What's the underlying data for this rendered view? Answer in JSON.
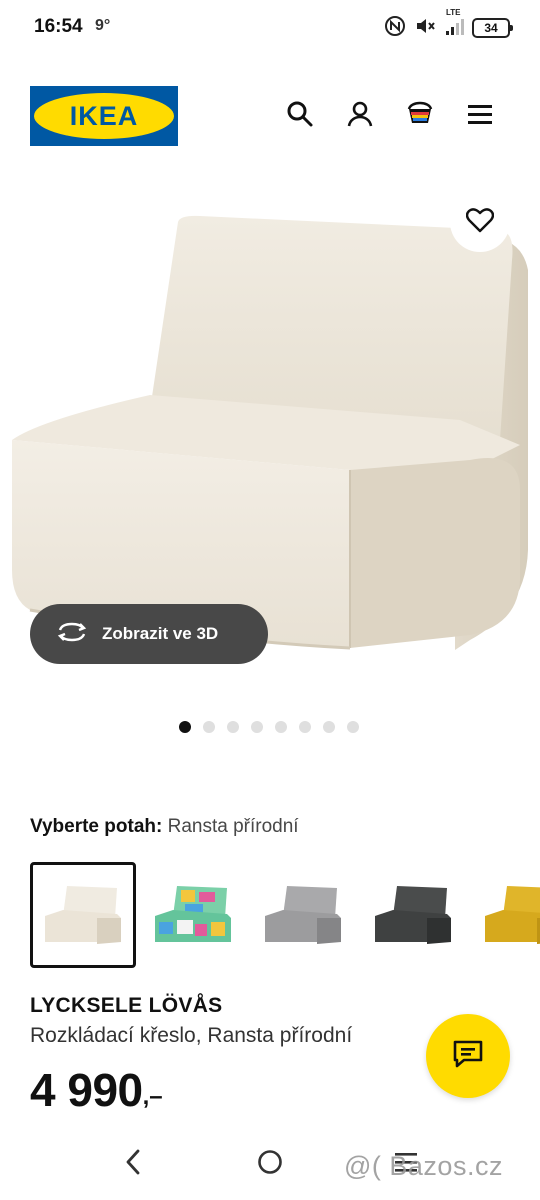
{
  "status_bar": {
    "time": "16:54",
    "temperature": "9°",
    "battery": "34",
    "icons": [
      "nfc-icon",
      "mute-icon",
      "lte-signal-icon",
      "battery-icon"
    ],
    "network_label": "LTE"
  },
  "header": {
    "logo_text": "IKEA",
    "icons": [
      "search-icon",
      "account-icon",
      "cart-icon",
      "menu-icon"
    ],
    "colors": {
      "ikea_blue": "#0058a3",
      "ikea_yellow": "#ffdb00"
    }
  },
  "gallery": {
    "favorite_icon": "heart-icon",
    "view_3d_label": "Zobrazit ve 3D",
    "view_3d_icon": "rotate-icon",
    "dot_count": 8,
    "active_dot": 0
  },
  "cover": {
    "label": "Vyberte potah:",
    "value": "Ransta přírodní",
    "swatches": [
      {
        "name": "ransta-natural",
        "color": "#efe9de",
        "selected": true
      },
      {
        "name": "multicolor",
        "color": "#6ec6a0",
        "selected": false
      },
      {
        "name": "light-grey",
        "color": "#9d9d9f",
        "selected": false
      },
      {
        "name": "dark-grey",
        "color": "#3f4141",
        "selected": false
      },
      {
        "name": "yellow",
        "color": "#d9ad1f",
        "selected": false
      }
    ]
  },
  "product": {
    "name": "LYCKSELE LÖVÅS",
    "description": "Rozkládací křeslo, Ransta přírodní",
    "price": "4 990",
    "price_suffix": ",–"
  },
  "chat": {
    "icon": "chat-icon"
  },
  "navbar": {
    "icons": [
      "back-icon",
      "home-icon",
      "recents-icon"
    ],
    "watermark": "@( Bazos.cz"
  }
}
